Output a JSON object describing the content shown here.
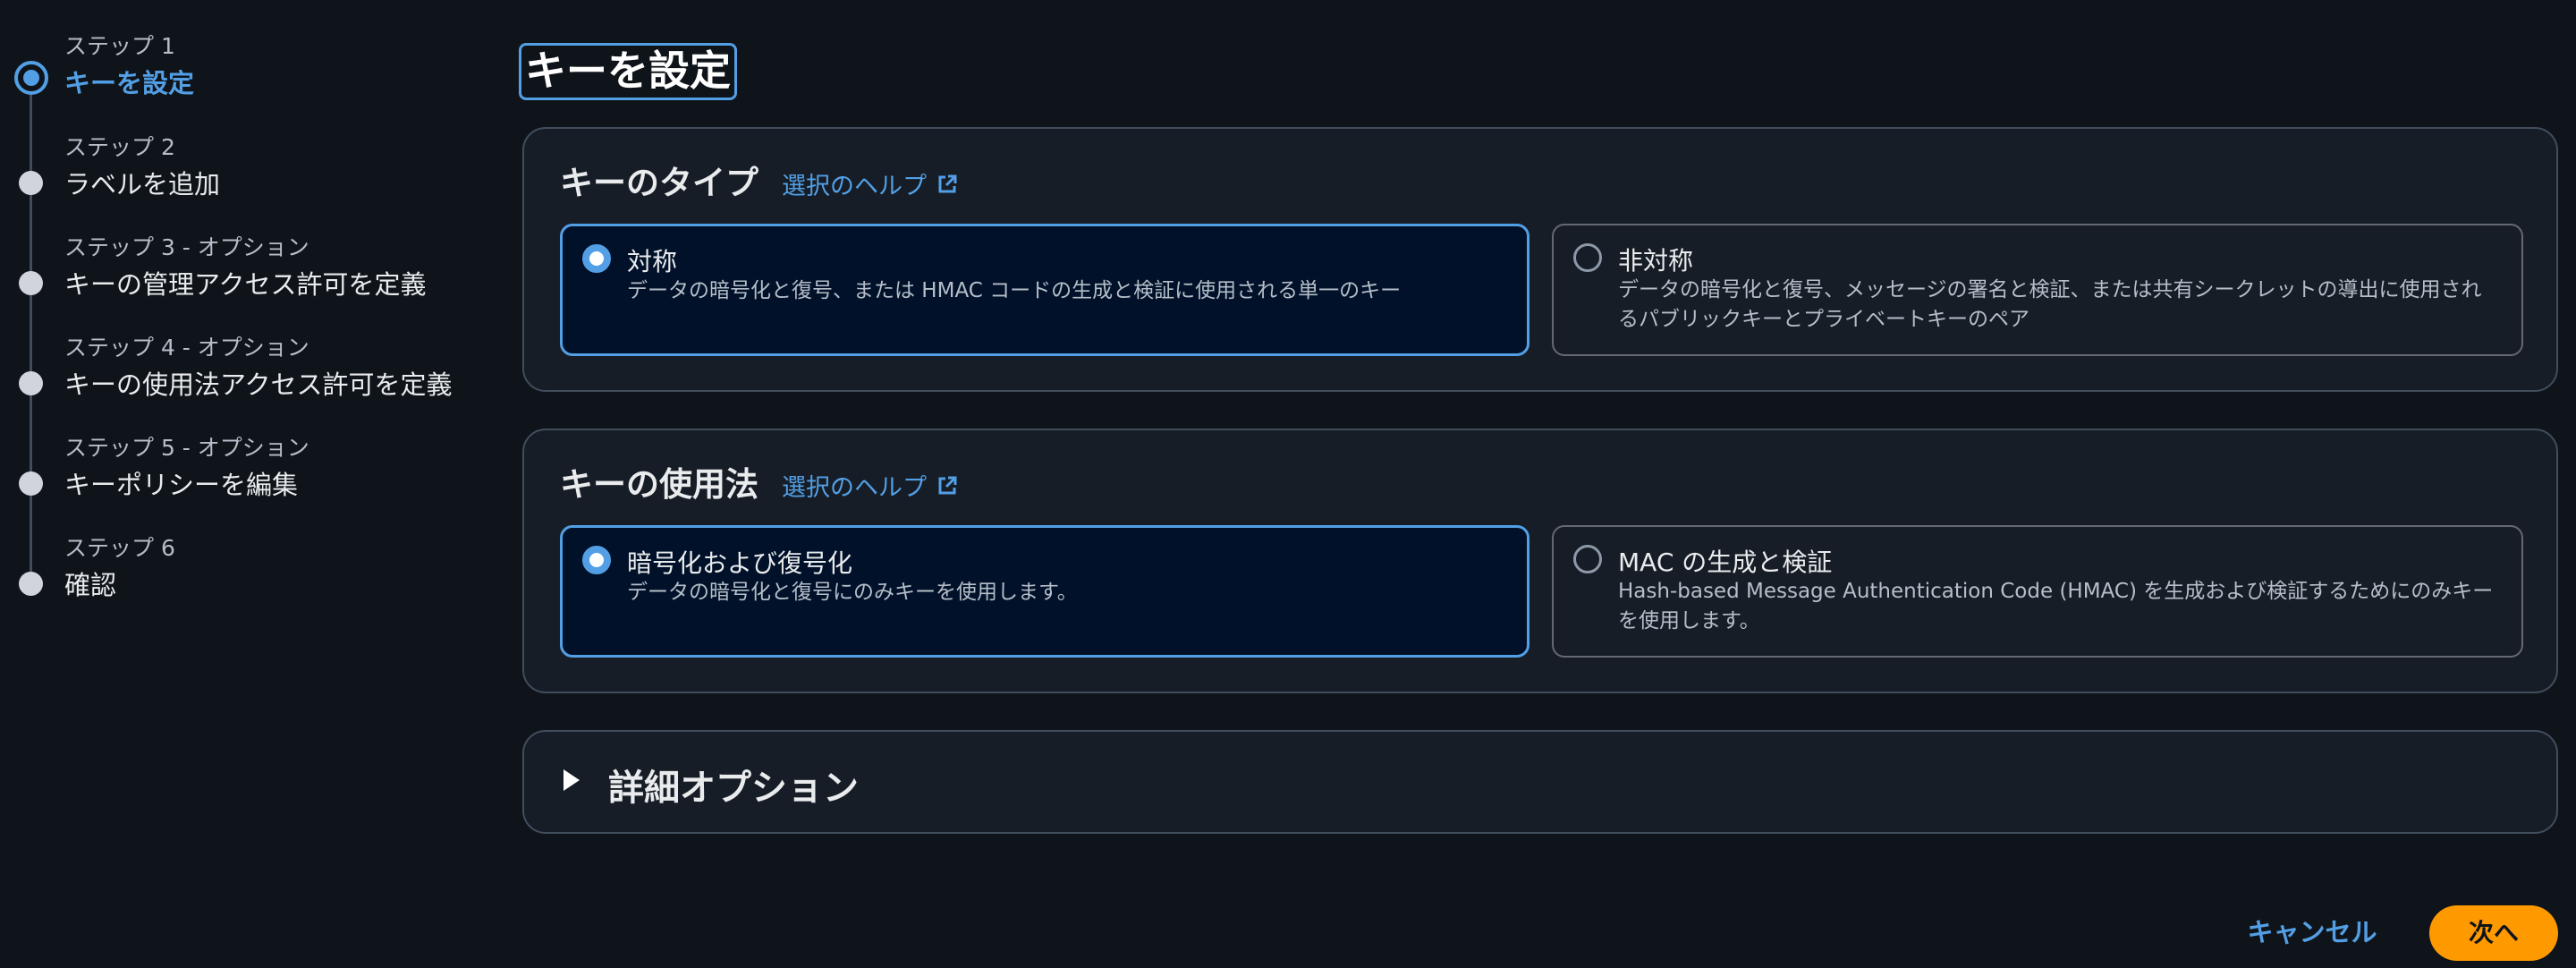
{
  "steps": [
    {
      "label": "ステップ 1",
      "title": "キーを設定"
    },
    {
      "label": "ステップ 2",
      "title": "ラベルを追加"
    },
    {
      "label": "ステップ 3 - オプション",
      "title": "キーの管理アクセス許可を定義"
    },
    {
      "label": "ステップ 4 - オプション",
      "title": "キーの使用法アクセス許可を定義"
    },
    {
      "label": "ステップ 5 - オプション",
      "title": "キーポリシーを編集"
    },
    {
      "label": "ステップ 6",
      "title": "確認"
    }
  ],
  "page_title": "キーを設定",
  "key_type": {
    "title": "キーのタイプ",
    "help": "選択のヘルプ",
    "options": [
      {
        "title": "対称",
        "description": "データの暗号化と復号、または HMAC コードの生成と検証に使用される単一のキー",
        "selected": true
      },
      {
        "title": "非対称",
        "description": "データの暗号化と復号、メッセージの署名と検証、または共有シークレットの導出に使用されるパブリックキーとプライベートキーのペア",
        "selected": false
      }
    ]
  },
  "key_usage": {
    "title": "キーの使用法",
    "help": "選択のヘルプ",
    "options": [
      {
        "title": "暗号化および復号化",
        "description": "データの暗号化と復号にのみキーを使用します。",
        "selected": true
      },
      {
        "title": "MAC の生成と検証",
        "description": "Hash-based Message Authentication Code (HMAC) を生成および検証するためにのみキーを使用します。",
        "selected": false
      }
    ]
  },
  "advanced": {
    "title": "詳細オプション"
  },
  "actions": {
    "cancel": "キャンセル",
    "next": "次へ"
  },
  "colors": {
    "accent": "#539fe5",
    "primary_button": "#ff9900",
    "background": "#0f141a",
    "panel": "#161d26"
  }
}
